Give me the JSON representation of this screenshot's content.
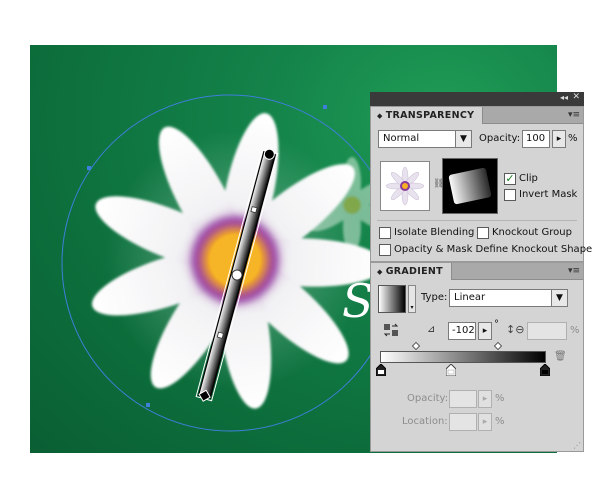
{
  "transparency": {
    "tab_label": "TRANSPARENCY",
    "blend_mode": "Normal",
    "opacity_label": "Opacity:",
    "opacity_value": "100",
    "opacity_unit": "%",
    "clip_label": "Clip",
    "clip_checked": true,
    "invert_mask_label": "Invert Mask",
    "isolate_blending_label": "Isolate Blending",
    "knockout_group_label": "Knockout Group",
    "opacity_mask_label": "Opacity & Mask Define Knockout Shape"
  },
  "gradient": {
    "tab_label": "GRADIENT",
    "type_label": "Type:",
    "type_value": "Linear",
    "angle_value": "-102",
    "degree_symbol": "°",
    "aspect_unit": "%",
    "opacity_label": "Opacity:",
    "opacity_unit": "%",
    "location_label": "Location:",
    "location_unit": "%"
  },
  "artwork": {
    "visible_text": "S",
    "colors": {
      "background": "#0d703d",
      "selection": "#3d7fd9",
      "petal": "#ffffff",
      "flower_center": "#f7b21f",
      "purple": "#7b2a8c"
    }
  },
  "icons": {
    "panel_menu": "panel-menu-icon",
    "collapse": "double-arrow-icon",
    "close": "close-icon",
    "reverse_gradient": "reverse-gradient-icon",
    "angle": "angle-icon",
    "aspect_ratio": "aspect-ratio-icon",
    "delete_stop": "trash-icon",
    "link": "link-chain-icon"
  }
}
